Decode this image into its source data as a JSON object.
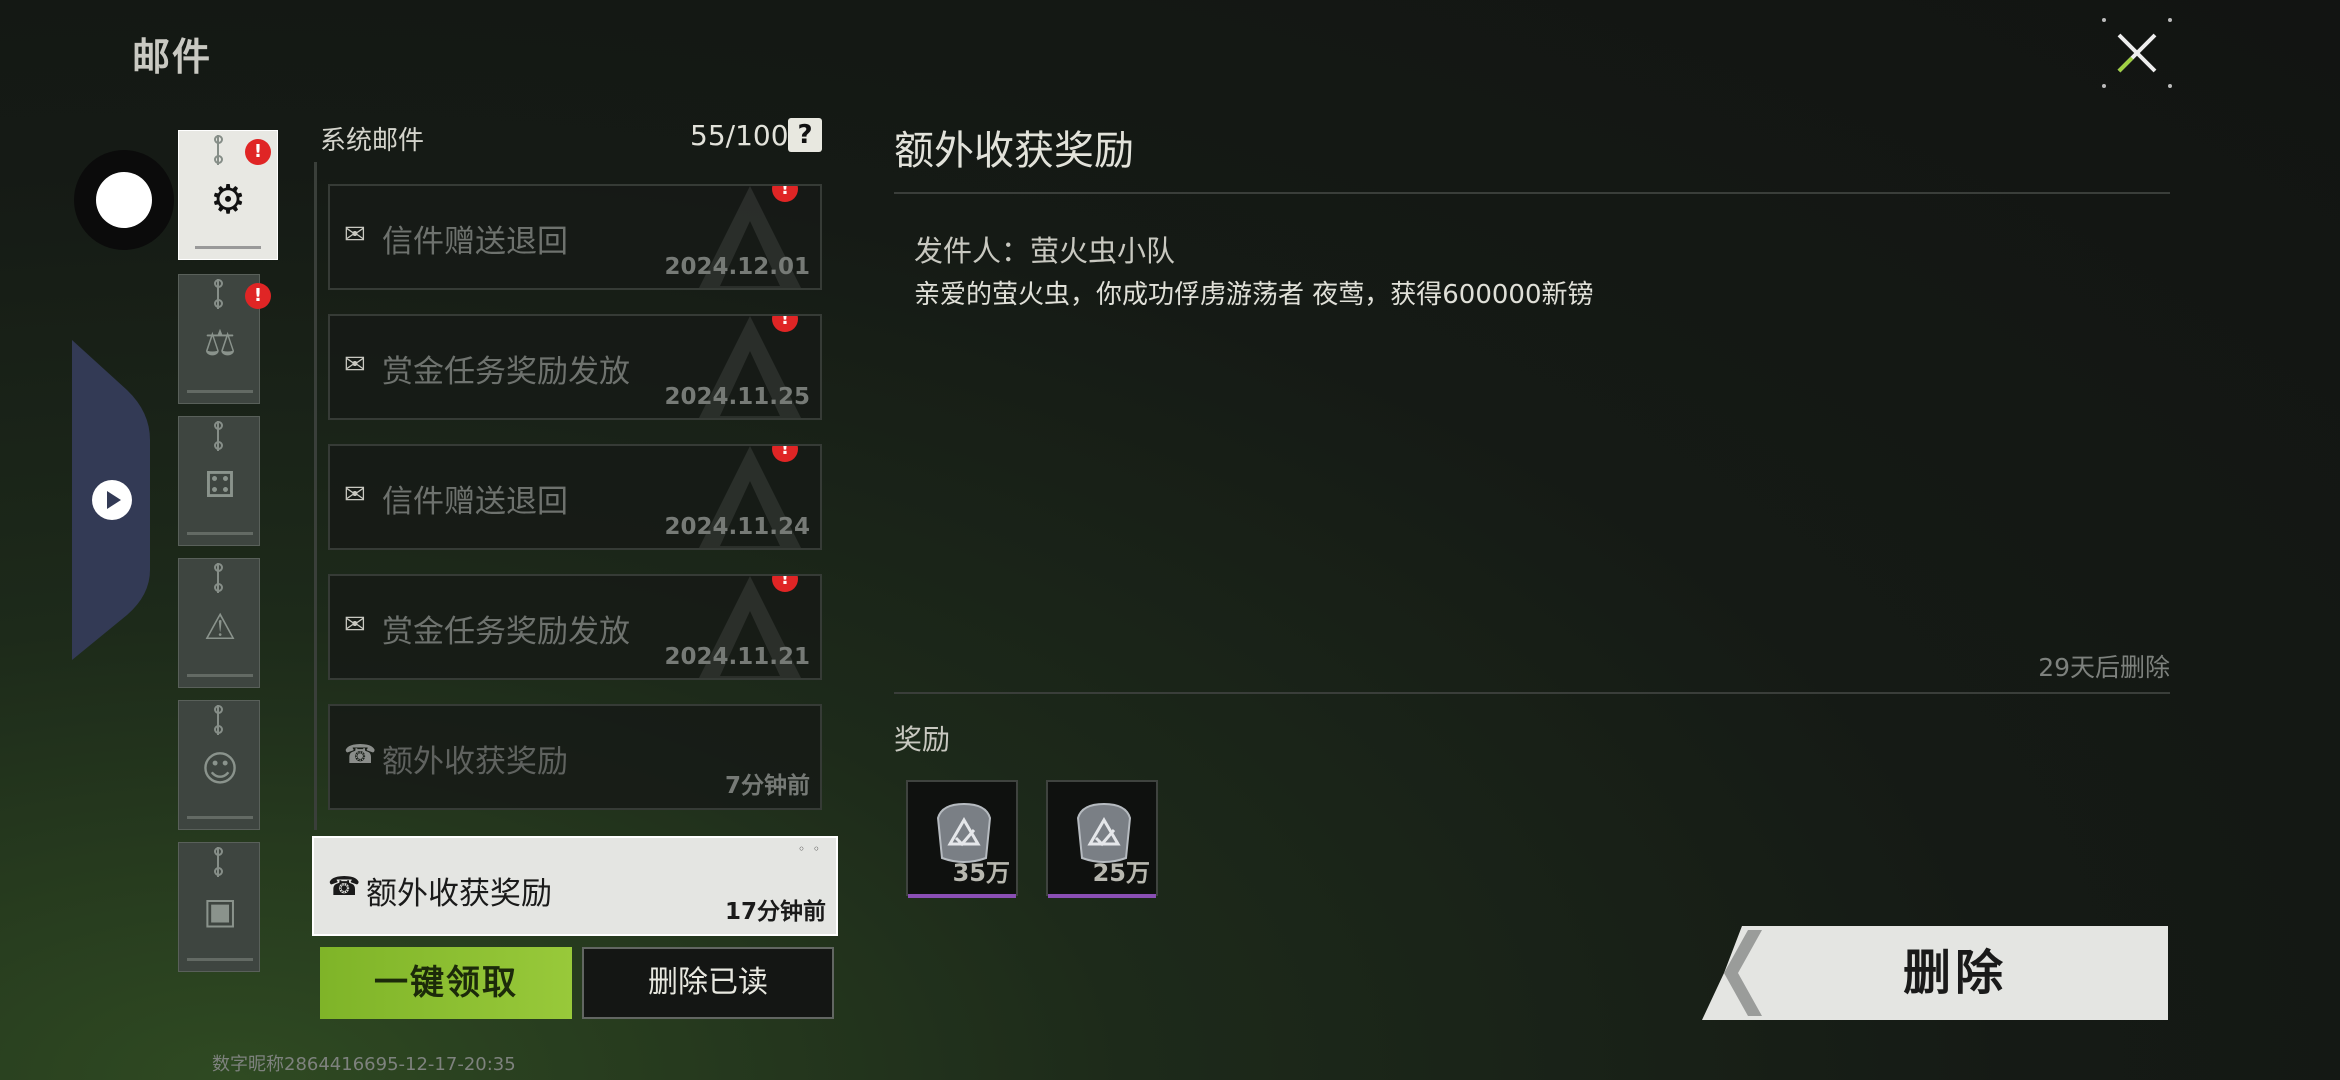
{
  "header": {
    "title": "邮件"
  },
  "categories": [
    {
      "id": "system",
      "icon": "gear-icon",
      "active": true,
      "unread": true
    },
    {
      "id": "bounty",
      "icon": "gavel-icon",
      "active": false,
      "unread": true
    },
    {
      "id": "dice",
      "icon": "dice-icon",
      "active": false,
      "unread": false
    },
    {
      "id": "warning",
      "icon": "warning-icon",
      "active": false,
      "unread": false
    },
    {
      "id": "character",
      "icon": "avatar-icon",
      "active": false,
      "unread": false
    },
    {
      "id": "backpack",
      "icon": "backpack-icon",
      "active": false,
      "unread": false
    }
  ],
  "list": {
    "label": "系统邮件",
    "count": "55/100",
    "help": "?",
    "items": [
      {
        "subject": "信件赠送退回",
        "date": "2024.12.01",
        "icon": "envelope-icon",
        "unread": true
      },
      {
        "subject": "赏金任务奖励发放",
        "date": "2024.11.25",
        "icon": "envelope-icon",
        "unread": true
      },
      {
        "subject": "信件赠送退回",
        "date": "2024.11.24",
        "icon": "envelope-icon",
        "unread": true
      },
      {
        "subject": "赏金任务奖励发放",
        "date": "2024.11.21",
        "icon": "envelope-icon",
        "unread": true
      },
      {
        "subject": "额外收获奖励",
        "date": "7分钟前",
        "icon": "gift-icon",
        "unread": false
      },
      {
        "subject": "额外收获奖励",
        "date": "17分钟前",
        "icon": "gift-icon",
        "unread": false,
        "selected": true
      }
    ]
  },
  "buttons": {
    "claim_all": "一键领取",
    "delete_read": "删除已读",
    "delete": "删除"
  },
  "footer": {
    "user_id": "数字昵称2864416695-12-17-20:35"
  },
  "detail": {
    "title": "额外收获奖励",
    "sender": "发件人：萤火虫小队",
    "body": "亲爱的萤火虫，你成功俘虏游荡者 夜莺，获得600000新镑",
    "expire": "29天后删除",
    "rewards_label": "奖励",
    "rewards": [
      {
        "item": "currency-bag-icon",
        "qty": "35万"
      },
      {
        "item": "currency-bag-icon",
        "qty": "25万"
      }
    ]
  },
  "colors": {
    "accent_green": "#8cc034",
    "badge_red": "#e02525",
    "reward_rarity": "#8a4fb4"
  }
}
